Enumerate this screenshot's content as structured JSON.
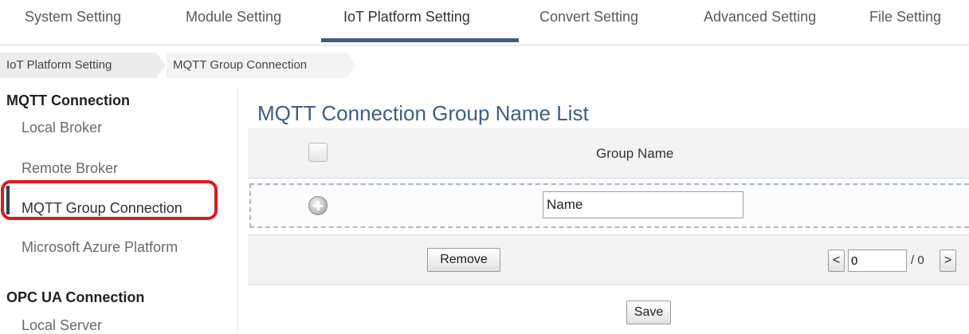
{
  "tabs": [
    {
      "label": "System Setting"
    },
    {
      "label": "Module Setting"
    },
    {
      "label": "IoT Platform Setting"
    },
    {
      "label": "Convert Setting"
    },
    {
      "label": "Advanced Setting"
    },
    {
      "label": "File Setting"
    }
  ],
  "breadcrumb": [
    "IoT Platform Setting",
    "MQTT Group Connection"
  ],
  "sidebar": {
    "mqtt_heading": "MQTT Connection",
    "items": [
      {
        "label": "Local Broker"
      },
      {
        "label": "Remote Broker"
      },
      {
        "label": "MQTT Group Connection"
      },
      {
        "label": "Microsoft Azure Platform"
      }
    ],
    "opcua_heading": "OPC UA Connection",
    "opcua_items": [
      {
        "label": "Local Server"
      }
    ]
  },
  "main": {
    "title": "MQTT Connection Group Name List",
    "column_header": "Group Name",
    "new_name_value": "Name",
    "remove_label": "Remove",
    "prev_label": "<",
    "page_value": "0",
    "page_total": "/ 0",
    "next_label": ">",
    "save_label": "Save"
  },
  "colors": {
    "accent": "#3b5f86",
    "highlight": "#e0191b"
  }
}
